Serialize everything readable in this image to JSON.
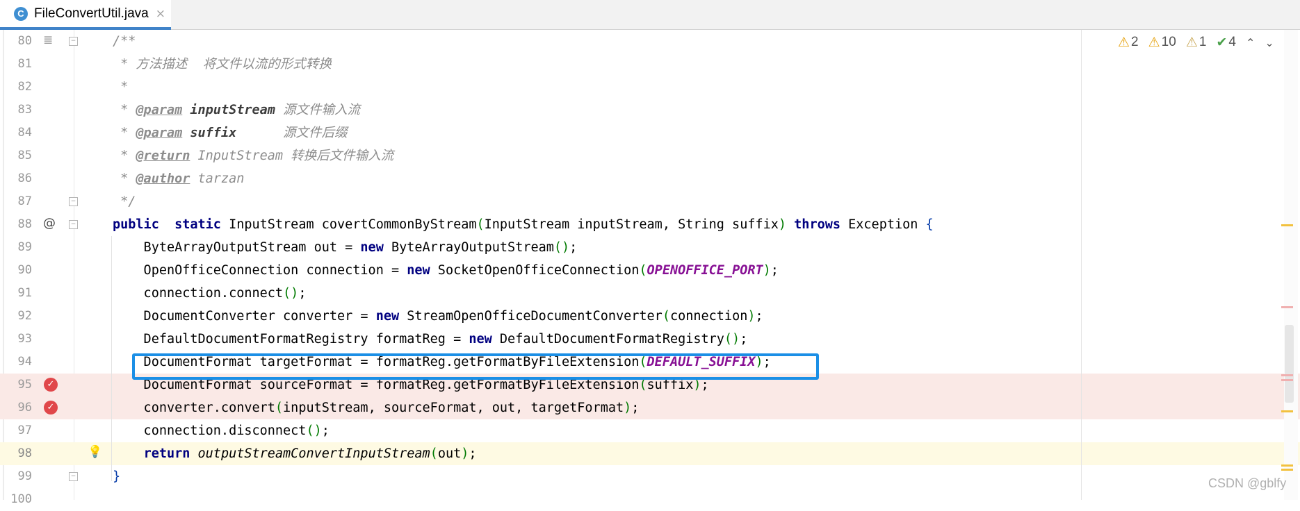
{
  "tab": {
    "icon_letter": "C",
    "title": "FileConvertUtil.java",
    "close": "×"
  },
  "inspections": {
    "errors": "2",
    "warnings": "10",
    "weak_warnings": "1",
    "typos": "4"
  },
  "lines": [
    {
      "n": "80",
      "tokens": [
        [
          "cmt",
          "/**"
        ]
      ]
    },
    {
      "n": "81",
      "tokens": [
        [
          "cmt",
          " * 方法描述  将文件以流的形式转换"
        ]
      ]
    },
    {
      "n": "82",
      "tokens": [
        [
          "cmt",
          " *"
        ]
      ]
    },
    {
      "n": "83",
      "tokens": [
        [
          "cmt",
          " * "
        ],
        [
          "tag",
          "@param"
        ],
        [
          "cmt",
          " "
        ],
        [
          "pname",
          "inputStream"
        ],
        [
          "cmt",
          " 源文件输入流"
        ]
      ]
    },
    {
      "n": "84",
      "tokens": [
        [
          "cmt",
          " * "
        ],
        [
          "tag",
          "@param"
        ],
        [
          "cmt",
          " "
        ],
        [
          "pname",
          "suffix"
        ],
        [
          "cmt",
          "      源文件后缀"
        ]
      ]
    },
    {
      "n": "85",
      "tokens": [
        [
          "cmt",
          " * "
        ],
        [
          "tag",
          "@return"
        ],
        [
          "cmt",
          " InputStream 转换后文件输入流"
        ]
      ]
    },
    {
      "n": "86",
      "tokens": [
        [
          "cmt",
          " * "
        ],
        [
          "tag",
          "@author"
        ],
        [
          "cmt",
          " tarzan"
        ]
      ]
    },
    {
      "n": "87",
      "tokens": [
        [
          "cmt",
          " */"
        ]
      ]
    },
    {
      "n": "88",
      "tokens": [
        [
          "kw2",
          "public"
        ],
        [
          "",
          "  "
        ],
        [
          "kw2",
          "static"
        ],
        [
          "",
          " InputStream covertCommonByStream"
        ],
        [
          "paren",
          "("
        ],
        [
          "",
          "InputStream inputStream, String suffix"
        ],
        [
          "paren",
          ")"
        ],
        [
          "",
          " "
        ],
        [
          "kw2",
          "throws"
        ],
        [
          "",
          " Exception "
        ],
        [
          "brace",
          "{"
        ]
      ]
    },
    {
      "n": "89",
      "tokens": [
        [
          "",
          "    ByteArrayOutputStream out = "
        ],
        [
          "kw2",
          "new"
        ],
        [
          "",
          " ByteArrayOutputStream"
        ],
        [
          "paren",
          "()"
        ],
        [
          "",
          ";"
        ]
      ]
    },
    {
      "n": "90",
      "tokens": [
        [
          "",
          "    OpenOfficeConnection connection = "
        ],
        [
          "kw2",
          "new"
        ],
        [
          "",
          " SocketOpenOfficeConnection"
        ],
        [
          "paren",
          "("
        ],
        [
          "cst",
          "OPENOFFICE_PORT"
        ],
        [
          "paren",
          ")"
        ],
        [
          "",
          ";"
        ]
      ]
    },
    {
      "n": "91",
      "tokens": [
        [
          "",
          "    connection.connect"
        ],
        [
          "paren",
          "()"
        ],
        [
          "",
          ";"
        ]
      ]
    },
    {
      "n": "92",
      "tokens": [
        [
          "",
          "    DocumentConverter converter = "
        ],
        [
          "kw2",
          "new"
        ],
        [
          "",
          " StreamOpenOfficeDocumentConverter"
        ],
        [
          "paren",
          "("
        ],
        [
          "",
          "connection"
        ],
        [
          "paren",
          ")"
        ],
        [
          "",
          ";"
        ]
      ]
    },
    {
      "n": "93",
      "tokens": [
        [
          "",
          "    DefaultDocumentFormatRegistry formatReg = "
        ],
        [
          "kw2",
          "new"
        ],
        [
          "",
          " DefaultDocumentFormatRegistry"
        ],
        [
          "paren",
          "()"
        ],
        [
          "",
          ";"
        ]
      ]
    },
    {
      "n": "94",
      "tokens": [
        [
          "",
          "    DocumentFormat targetFormat = formatReg.getFormatByFileExtension"
        ],
        [
          "paren",
          "("
        ],
        [
          "cst",
          "DEFAULT_SUFFIX"
        ],
        [
          "paren",
          ")"
        ],
        [
          "",
          ";"
        ]
      ]
    },
    {
      "n": "95",
      "tokens": [
        [
          "",
          "    DocumentFormat sourceFormat = formatReg.getFormatByFileExtension"
        ],
        [
          "paren",
          "("
        ],
        [
          "",
          "suffix"
        ],
        [
          "paren",
          ")"
        ],
        [
          "",
          ";"
        ]
      ]
    },
    {
      "n": "96",
      "tokens": [
        [
          "",
          "    converter.convert"
        ],
        [
          "paren",
          "("
        ],
        [
          "",
          "inputStream, sourceFormat, out, targetFormat"
        ],
        [
          "paren",
          ")"
        ],
        [
          "",
          ";"
        ]
      ]
    },
    {
      "n": "97",
      "tokens": [
        [
          "",
          "    connection.disconnect"
        ],
        [
          "paren",
          "()"
        ],
        [
          "",
          ";"
        ]
      ]
    },
    {
      "n": "98",
      "tokens": [
        [
          "",
          "    "
        ],
        [
          "kw2",
          "return"
        ],
        [
          "",
          " "
        ],
        [
          "itl",
          "outputStreamConvertInputStream"
        ],
        [
          "paren",
          "("
        ],
        [
          "",
          "out"
        ],
        [
          "paren",
          ")"
        ],
        [
          "",
          ";"
        ]
      ]
    },
    {
      "n": "99",
      "tokens": [
        [
          "brace",
          "}"
        ]
      ]
    },
    {
      "n": "100",
      "tokens": []
    }
  ],
  "watermark": "CSDN @gblfy"
}
